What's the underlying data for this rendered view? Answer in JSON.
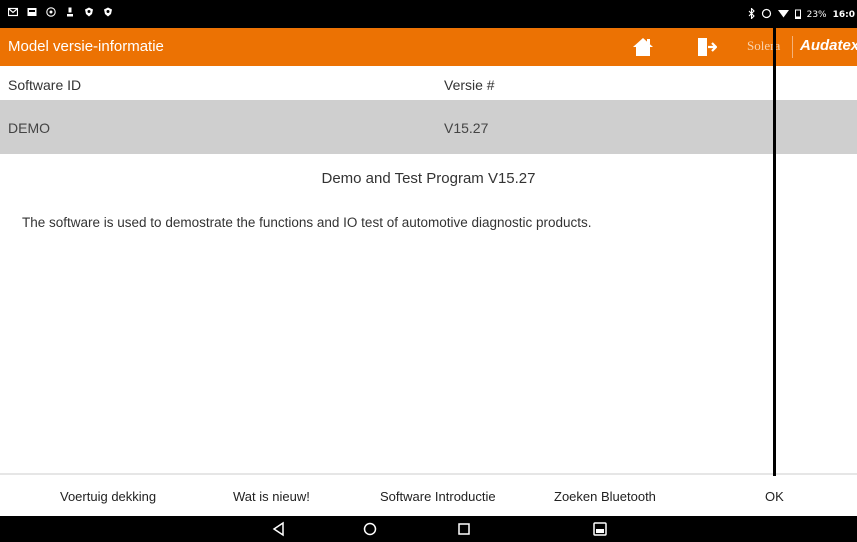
{
  "status_bar": {
    "left_icons": [
      "mail-icon",
      "image-icon",
      "usb-icon",
      "download-icon",
      "shield-icon",
      "shield-icon"
    ],
    "battery": "23%",
    "time": "16:0"
  },
  "app_bar": {
    "title": "Model versie-informatie",
    "brand_secondary": "Solera",
    "brand_primary": "Audatex",
    "accent_color": "#ec7203"
  },
  "table": {
    "headers": [
      "Software ID",
      "Versie #"
    ],
    "rows": [
      {
        "software_id": "DEMO",
        "version": "V15.27"
      }
    ]
  },
  "program": {
    "title": "Demo and Test Program V15.27",
    "description": "The software is used to demostrate the functions and IO test of automotive diagnostic products."
  },
  "bottom_buttons": [
    {
      "label": "Voertuig dekking"
    },
    {
      "label": "Wat is nieuw!"
    },
    {
      "label": "Software Introductie"
    },
    {
      "label": "Zoeken Bluetooth"
    },
    {
      "label": "OK"
    }
  ],
  "nav_buttons": [
    "back-icon",
    "home-circle-icon",
    "recents-icon",
    "screenshot-icon"
  ]
}
